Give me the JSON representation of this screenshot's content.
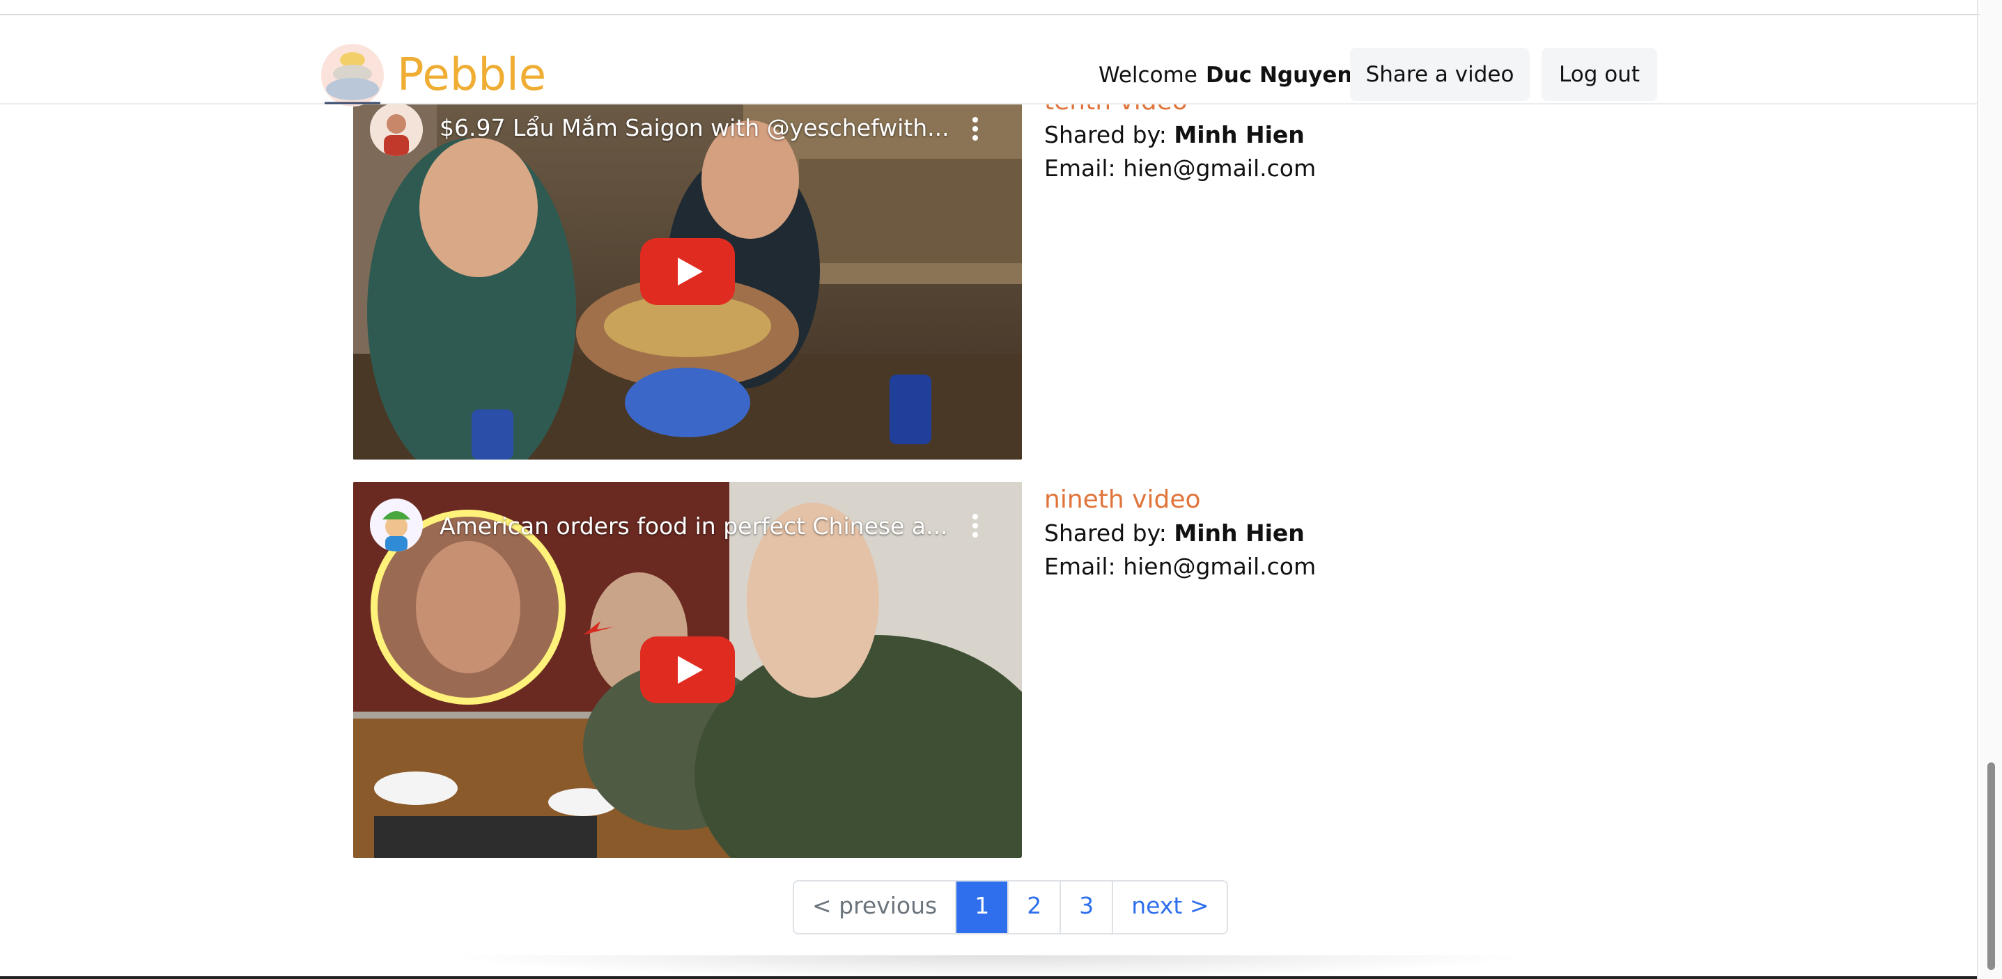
{
  "header": {
    "brand": "Pebble",
    "welcome_label": "Welcome",
    "username": "Duc Nguyen",
    "share_button": "Share a video",
    "logout_button": "Log out"
  },
  "videos": [
    {
      "title": "tenth video",
      "shared_by_label": "Shared by:",
      "shared_by": "Minh Hien",
      "email_label": "Email:",
      "email": "hien@gmail.com",
      "embed_title": "$6.97 Lẩu Mắm Saigon with @yeschefwith..."
    },
    {
      "title": "nineth video",
      "shared_by_label": "Shared by:",
      "shared_by": "Minh Hien",
      "email_label": "Email:",
      "email": "hien@gmail.com",
      "embed_title": "American orders food in perfect Chinese a..."
    }
  ],
  "pagination": {
    "previous": "< previous",
    "pages": [
      "1",
      "2",
      "3"
    ],
    "current": "1",
    "next": "next >"
  },
  "colors": {
    "brand": "#f0ad34",
    "video_title": "#e0743a",
    "link": "#2f6fed",
    "play_button": "#e02b20"
  }
}
